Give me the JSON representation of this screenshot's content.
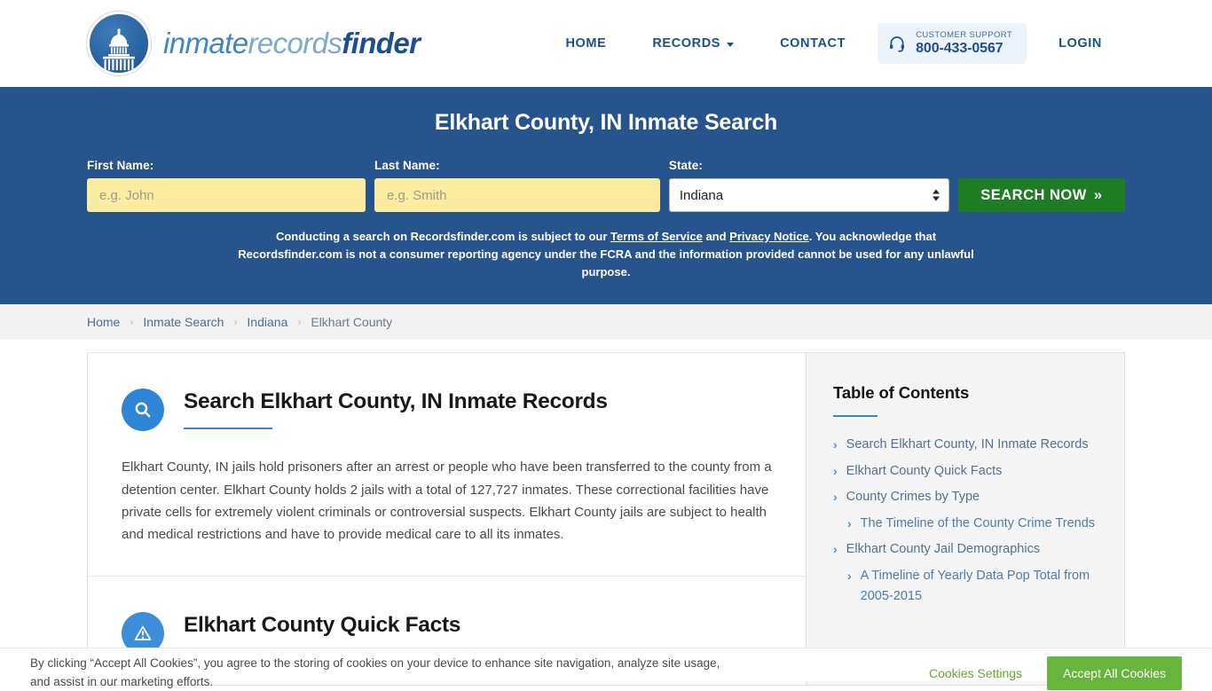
{
  "header": {
    "brand": {
      "part1": "inmate",
      "part2": "records",
      "part3": "finder",
      "logo_icon": "capitol-dome-icon"
    },
    "nav": [
      {
        "label": "HOME",
        "name": "nav-home",
        "caret": false
      },
      {
        "label": "RECORDS",
        "name": "nav-records",
        "caret": true
      },
      {
        "label": "CONTACT",
        "name": "nav-contact",
        "caret": false
      }
    ],
    "support": {
      "icon": "headset-icon",
      "label": "CUSTOMER SUPPORT",
      "phone": "800-433-0567"
    },
    "login": "LOGIN"
  },
  "hero": {
    "title": "Elkhart County, IN Inmate Search",
    "first_name": {
      "label": "First Name:",
      "placeholder": "e.g. John",
      "value": ""
    },
    "last_name": {
      "label": "Last Name:",
      "placeholder": "e.g. Smith",
      "value": ""
    },
    "state": {
      "label": "State:",
      "value": "Indiana"
    },
    "search_button": "SEARCH NOW",
    "search_button_chevron": "»",
    "disclaimer": {
      "part1": "Conducting a search on Recordsfinder.com is subject to our ",
      "link1": "Terms of Service",
      "mid": " and ",
      "link2": "Privacy Notice",
      "part2": ". You acknowledge that Recordsfinder.com is not a consumer reporting agency under the FCRA and the information provided cannot be used for any unlawful purpose."
    }
  },
  "breadcrumb": {
    "separator": "›",
    "items": [
      {
        "label": "Home",
        "current": false
      },
      {
        "label": "Inmate Search",
        "current": false
      },
      {
        "label": "Indiana",
        "current": false
      },
      {
        "label": "Elkhart County",
        "current": true
      }
    ]
  },
  "main": {
    "sections": [
      {
        "icon": "search-magnifier-icon",
        "title": "Search Elkhart County, IN Inmate Records",
        "body": "Elkhart County, IN jails hold prisoners after an arrest or people who have been transferred to the county from a detention center. Elkhart County holds 2 jails with a total of 127,727 inmates. These correctional facilities have private cells for extremely violent criminals or controversial suspects. Elkhart County jails are subject to health and medical restrictions and have to provide medical care to all its inmates."
      },
      {
        "icon": "alert-exclamation-icon",
        "title": "Elkhart County Quick Facts",
        "body": ""
      }
    ]
  },
  "toc": {
    "title": "Table of Contents",
    "chevron": "›",
    "items": [
      {
        "label": "Search Elkhart County, IN Inmate Records",
        "sub": false
      },
      {
        "label": "Elkhart County Quick Facts",
        "sub": false
      },
      {
        "label": "County Crimes by Type",
        "sub": false
      },
      {
        "label": "The Timeline of the County Crime Trends",
        "sub": true
      },
      {
        "label": "Elkhart County Jail Demographics",
        "sub": false
      },
      {
        "label": "A Timeline of Yearly Data Pop Total from 2005-2015",
        "sub": true
      }
    ]
  },
  "cookie_banner": {
    "text": "By clicking “Accept All Cookies”, you agree to the storing of cookies on your device to enhance site navigation, analyze site usage, and assist in our marketing efforts.",
    "settings_label": "Cookies Settings",
    "accept_label": "Accept All Cookies"
  },
  "colors": {
    "hero_blue": "#27548c",
    "brand_blue": "#1d4f8c",
    "accent_blue": "#3f84c6",
    "search_green": "#1e7d22",
    "input_yellow": "#fbeca0",
    "cookie_green": "#69b43c"
  }
}
